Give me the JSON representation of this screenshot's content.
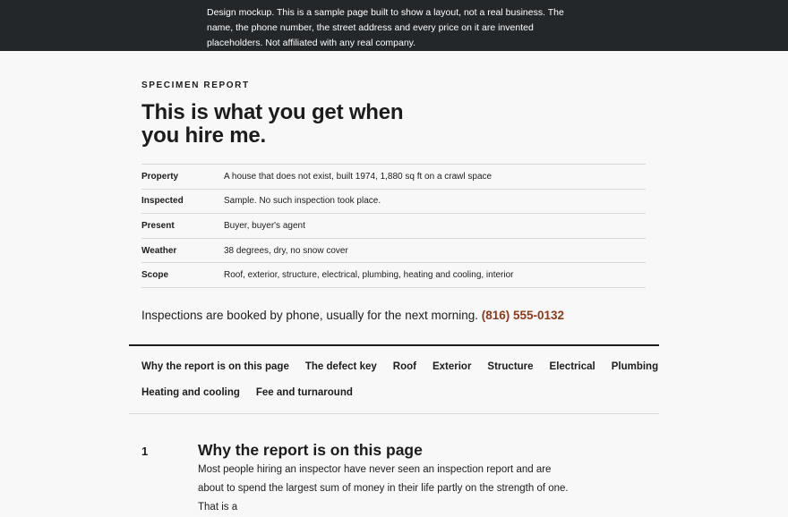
{
  "banner": {
    "text": "Design mockup. This is a sample page built to show a layout, not a real business. The name, the phone number, the street address and every price on it are invented placeholders. Not affiliated with any real company."
  },
  "report": {
    "eyebrow": "SPECIMEN REPORT",
    "title": "This is what you get when you hire me.",
    "facts": [
      {
        "label": "Property",
        "value": "A house that does not exist, built 1974, 1,880 sq ft on a crawl space"
      },
      {
        "label": "Inspected",
        "value": "Sample. No such inspection took place."
      },
      {
        "label": "Present",
        "value": "Buyer, buyer's agent"
      },
      {
        "label": "Weather",
        "value": "38 degrees, dry, no snow cover"
      },
      {
        "label": "Scope",
        "value": "Roof, exterior, structure, electrical, plumbing, heating and cooling, interior"
      }
    ],
    "booking_text": "Inspections are booked by phone, usually for the next morning.",
    "phone": "(816) 555-0132"
  },
  "nav": {
    "items": [
      "Why the report is on this page",
      "The defect key",
      "Roof",
      "Exterior",
      "Structure",
      "Electrical",
      "Plumbing",
      "Heating and cooling",
      "Fee and turnaround"
    ]
  },
  "section1": {
    "number": "1",
    "title": "Why the report is on this page",
    "body": "Most people hiring an inspector have never seen an inspection report and are about to spend the largest sum of money in their life partly on the strength of one. That is a"
  },
  "colors": {
    "banner_bg": "#24272a",
    "page_bg": "#f8f8f8",
    "accent": "#8a3b1c",
    "text": "#1c1c1c"
  }
}
